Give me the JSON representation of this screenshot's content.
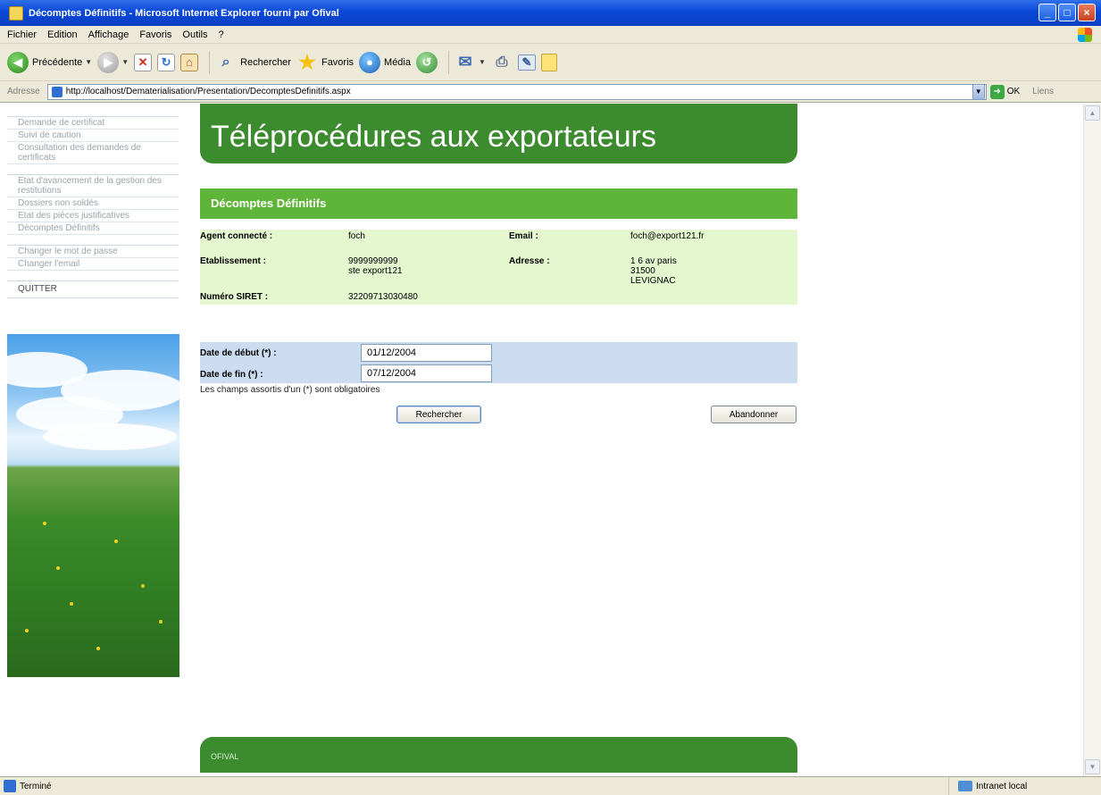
{
  "window": {
    "title": "Décomptes Définitifs - Microsoft Internet Explorer fourni par Ofival",
    "minimize": "_",
    "maximize": "□",
    "close": "×"
  },
  "menu": [
    "Fichier",
    "Edition",
    "Affichage",
    "Favoris",
    "Outils",
    "?"
  ],
  "toolbar": {
    "back_label": "Précédente",
    "search_label": "Rechercher",
    "favorites_label": "Favoris",
    "media_label": "Média"
  },
  "address": {
    "label": "Adresse",
    "url": "http://localhost/Dematerialisation/Presentation/DecomptesDefinitifs.aspx",
    "go_label": "OK",
    "links_label": "Liens"
  },
  "nav": {
    "group1": [
      "Demande de certificat",
      "Suivi de caution",
      "Consultation des demandes de certificats"
    ],
    "group2": [
      "Etat d'avancement de la gestion des restitutions",
      "Dossiers non soldés",
      "Etat des pièces justificatives",
      "Décomptes Définitifs"
    ],
    "group3": [
      "Changer le mot de passe",
      "Changer l'email"
    ],
    "quit": "QUITTER"
  },
  "banner": {
    "title": "Téléprocédures aux exportateurs"
  },
  "section": {
    "title": "Décomptes Définitifs"
  },
  "info": {
    "agent_label": "Agent connecté :",
    "agent_value": "foch",
    "email_label": "Email :",
    "email_value": "foch@export121.fr",
    "etab_label": "Etablissement :",
    "etab_value": "9999999999\nste export121",
    "adresse_label": "Adresse :",
    "adresse_value": "1 6 av paris\n31500\nLEVIGNAC",
    "siret_label": "Numéro SIRET :",
    "siret_value": "32209713030480"
  },
  "form": {
    "start_label": "Date de début (*) :",
    "start_value": "01/12/2004",
    "end_label": "Date de fin (*) :",
    "end_value": "07/12/2004",
    "hint": "Les champs assortis d'un (*) sont obligatoires",
    "search_button": "Rechercher",
    "cancel_button": "Abandonner"
  },
  "footer": {
    "text": "OFIVAL"
  },
  "status": {
    "text": "Terminé",
    "zone": "Intranet local"
  }
}
